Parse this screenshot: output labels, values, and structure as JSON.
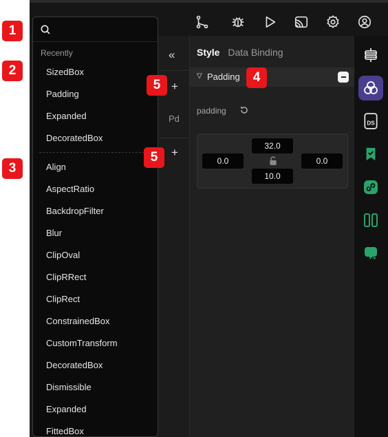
{
  "topbar": {
    "icons": [
      "branch-icon",
      "bug-icon",
      "play-icon",
      "cast-icon",
      "settings-icon",
      "account-icon"
    ]
  },
  "search": {
    "value": "",
    "placeholder": ""
  },
  "dropdown": {
    "recently_label": "Recently",
    "recent_items": [
      "SizedBox",
      "Padding",
      "Expanded",
      "DecoratedBox"
    ],
    "all_items": [
      "Align",
      "AspectRatio",
      "BackdropFilter",
      "Blur",
      "ClipOval",
      "ClipRRect",
      "ClipRect",
      "ConstrainedBox",
      "CustomTransform",
      "DecoratedBox",
      "Dismissible",
      "Expanded",
      "FittedBox"
    ]
  },
  "midcol": {
    "collapse_icon": "«",
    "plus1": "+",
    "plus2": "+",
    "widget_abbrev": "Pd"
  },
  "panel": {
    "tabs": {
      "style": "Style",
      "binding": "Data Binding"
    },
    "section_title": "Padding",
    "prop_label": "padding",
    "values": {
      "top": "32.0",
      "left": "0.0",
      "right": "0.0",
      "bottom": "10.0"
    }
  },
  "rightbar": {
    "icons": [
      "sliders-icon",
      "layers-icon",
      "ds-icon",
      "bookmark-check-icon",
      "link-icon",
      "columns-icon",
      "comment-icon"
    ],
    "active_color": "#4a3f8f",
    "accent_green": "#2aa36b"
  },
  "badges": [
    "1",
    "2",
    "3",
    "4",
    "5",
    "5"
  ],
  "colors": {
    "badge_red": "#e8171c"
  }
}
